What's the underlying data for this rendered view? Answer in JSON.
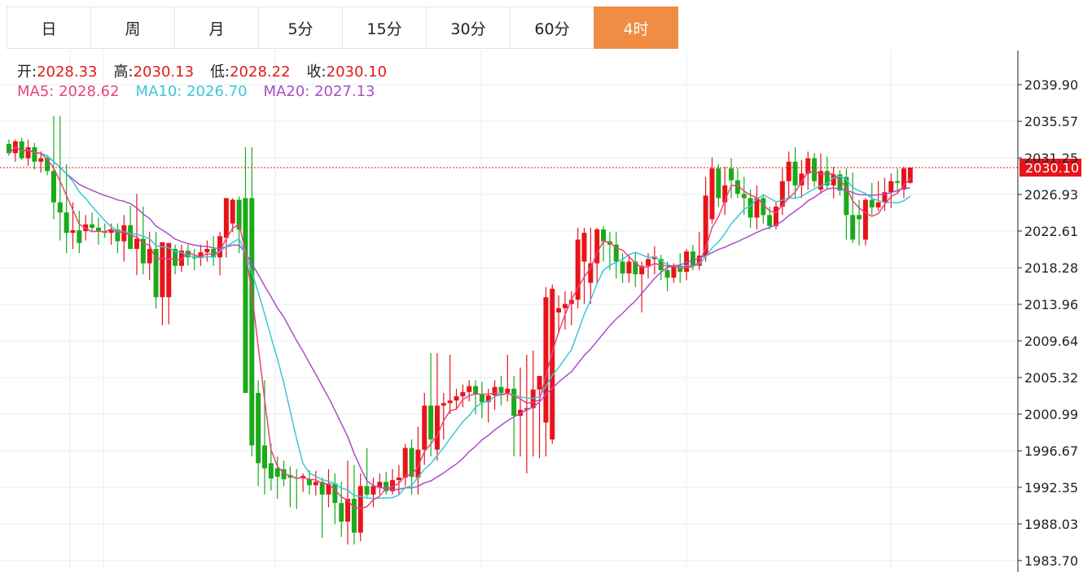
{
  "tabs": [
    {
      "label": "日",
      "active": false
    },
    {
      "label": "周",
      "active": false
    },
    {
      "label": "月",
      "active": false
    },
    {
      "label": "5分",
      "active": false
    },
    {
      "label": "15分",
      "active": false
    },
    {
      "label": "30分",
      "active": false
    },
    {
      "label": "60分",
      "active": false
    },
    {
      "label": "4时",
      "active": true
    }
  ],
  "ohlc": {
    "open_label": "开:",
    "open": "2028.33",
    "high_label": "高:",
    "high": "2030.13",
    "low_label": "低:",
    "low": "2028.22",
    "close_label": "收:",
    "close": "2030.10"
  },
  "ma": {
    "ma5_label": "MA5:",
    "ma5": "2028.62",
    "ma10_label": "MA10:",
    "ma10": "2026.70",
    "ma20_label": "MA20:",
    "ma20": "2027.13"
  },
  "colors": {
    "up": "#e8141a",
    "down": "#1aaa1a",
    "ma5": "#e8457a",
    "ma10": "#3cc7d6",
    "ma20": "#a94fc4",
    "accent": "#f08c44",
    "last_price_bg": "#e8141a"
  },
  "chart_data": {
    "type": "candlestick",
    "y_ticks": [
      "2039.90",
      "2035.57",
      "2031.25",
      "2026.93",
      "2022.61",
      "2018.28",
      "2013.96",
      "2009.64",
      "2005.32",
      "2000.99",
      "1996.67",
      "1992.35",
      "1988.03",
      "1983.70"
    ],
    "ylim": [
      1983.7,
      2039.9
    ],
    "last_price": "2030.10",
    "grid": true,
    "candles": [
      [
        2032.9,
        2033.4,
        2031.5,
        2031.8
      ],
      [
        2031.8,
        2033.4,
        2030.8,
        2033.2
      ],
      [
        2033.2,
        2033.6,
        2031.0,
        2031.2
      ],
      [
        2031.2,
        2033.4,
        2030.3,
        2032.5
      ],
      [
        2032.5,
        2033.0,
        2029.9,
        2030.8
      ],
      [
        2030.8,
        2032.0,
        2029.5,
        2031.2
      ],
      [
        2031.2,
        2031.6,
        2029.2,
        2029.7
      ],
      [
        2029.7,
        2036.2,
        2024.0,
        2026.0
      ],
      [
        2026.0,
        2036.2,
        2021.5,
        2024.8
      ],
      [
        2024.8,
        2030.5,
        2020.0,
        2022.4
      ],
      [
        2022.4,
        2026.0,
        2020.5,
        2022.7
      ],
      [
        2022.7,
        2025.0,
        2020.0,
        2021.2
      ],
      [
        2022.6,
        2024.5,
        2021.5,
        2023.4
      ],
      [
        2023.4,
        2024.8,
        2022.5,
        2023.0
      ],
      [
        2023.0,
        2024.2,
        2021.0,
        2022.6
      ],
      [
        2022.6,
        2023.5,
        2021.8,
        2022.4
      ],
      [
        2022.4,
        2023.5,
        2021.0,
        2022.8
      ],
      [
        2022.8,
        2023.5,
        2020.0,
        2021.4
      ],
      [
        2021.4,
        2024.5,
        2019.0,
        2023.3
      ],
      [
        2023.3,
        2025.6,
        2020.5,
        2020.5
      ],
      [
        2020.5,
        2027.0,
        2017.4,
        2021.7
      ],
      [
        2021.7,
        2025.5,
        2017.5,
        2018.8
      ],
      [
        2018.8,
        2022.5,
        2016.8,
        2020.5
      ],
      [
        2020.5,
        2022.5,
        2013.5,
        2014.8
      ],
      [
        2014.8,
        2021.0,
        2011.5,
        2021.3
      ],
      [
        2014.8,
        2021.0,
        2011.6,
        2021.2
      ],
      [
        2020.5,
        2021.0,
        2017.5,
        2018.5
      ],
      [
        2018.5,
        2021.0,
        2017.8,
        2020.3
      ],
      [
        2020.3,
        2021.0,
        2018.5,
        2019.5
      ],
      [
        2019.5,
        2020.5,
        2018.0,
        2019.4
      ],
      [
        2019.5,
        2021.0,
        2018.5,
        2020.1
      ],
      [
        2020.1,
        2021.5,
        2019.0,
        2020.5
      ],
      [
        2020.5,
        2022.0,
        2018.5,
        2019.5
      ],
      [
        2019.5,
        2022.5,
        2017.4,
        2022.0
      ],
      [
        2021.8,
        2024.5,
        2019.5,
        2026.5
      ],
      [
        2023.5,
        2026.5,
        2022.5,
        2026.3
      ],
      [
        2026.3,
        2026.7,
        2020.0,
        2022.8
      ],
      [
        2026.5,
        2032.5,
        2005.0,
        2003.5
      ],
      [
        2026.5,
        2032.5,
        1996.0,
        1997.3
      ],
      [
        2003.5,
        2005.0,
        1992.5,
        1995.2
      ],
      [
        1997.3,
        2005.0,
        1991.5,
        1994.6
      ],
      [
        1995.2,
        1997.5,
        1992.0,
        1993.4
      ],
      [
        1994.6,
        1996.0,
        1991.0,
        1993.6
      ],
      [
        1994.5,
        1995.5,
        1992.5,
        1993.3
      ],
      [
        1993.8,
        1994.8,
        1990.0,
        1993.5
      ],
      [
        1993.5,
        1994.5,
        1989.8,
        1993.4
      ],
      [
        1993.4,
        1994.0,
        1991.8,
        1993.7
      ],
      [
        1993.3,
        1994.4,
        1991.5,
        1992.6
      ],
      [
        1992.6,
        1994.3,
        1991.4,
        1993.0
      ],
      [
        1993.0,
        1993.5,
        1986.4,
        1991.5
      ],
      [
        1991.5,
        1994.5,
        1990.0,
        1992.8
      ],
      [
        1992.8,
        1994.0,
        1988.0,
        1990.5
      ],
      [
        1990.5,
        1993.0,
        1986.5,
        1988.3
      ],
      [
        1988.3,
        1995.5,
        1985.6,
        1991.0
      ],
      [
        1991.0,
        1995.0,
        1985.6,
        1987.0
      ],
      [
        1987.0,
        1994.0,
        1986.0,
        1992.5
      ],
      [
        1992.5,
        1997.0,
        1991.2,
        1991.5
      ],
      [
        1991.5,
        1993.5,
        1990.0,
        1992.5
      ],
      [
        1992.3,
        1994.0,
        1991.5,
        1993.0
      ],
      [
        1993.0,
        1994.2,
        1991.5,
        1991.9
      ],
      [
        1991.9,
        1994.5,
        1991.5,
        1993.2
      ],
      [
        1993.2,
        1995.0,
        1991.5,
        1993.5
      ],
      [
        1993.5,
        1997.5,
        1992.5,
        1997.0
      ],
      [
        1997.0,
        1998.0,
        1991.5,
        1993.6
      ],
      [
        1993.5,
        1999.5,
        1991.5,
        1996.8
      ],
      [
        1996.8,
        2003.5,
        1995.0,
        2002.0
      ],
      [
        2002.0,
        2008.2,
        1996.0,
        1998.0
      ],
      [
        1996.8,
        2008.2,
        1995.5,
        2002.0
      ],
      [
        2002.0,
        2003.5,
        1998.0,
        2002.3
      ],
      [
        2002.3,
        2008.0,
        2001.0,
        2002.6
      ],
      [
        2002.6,
        2004.0,
        2001.5,
        2003.1
      ],
      [
        2003.1,
        2004.5,
        2001.8,
        2003.6
      ],
      [
        2003.6,
        2005.0,
        2002.5,
        2004.3
      ],
      [
        2004.3,
        2005.0,
        2001.0,
        2003.3
      ],
      [
        2003.3,
        2004.8,
        2000.5,
        2002.4
      ],
      [
        2002.4,
        2004.0,
        2000.0,
        2003.2
      ],
      [
        2003.2,
        2005.0,
        2001.5,
        2004.2
      ],
      [
        2004.2,
        2005.5,
        2002.0,
        2003.5
      ],
      [
        2003.5,
        2008.0,
        2002.5,
        2004.0
      ],
      [
        2004.0,
        2005.5,
        1996.0,
        2000.8
      ],
      [
        2000.8,
        2006.5,
        1996.0,
        2001.5
      ],
      [
        2001.5,
        2008.0,
        1994.0,
        2001.7
      ],
      [
        2001.7,
        2008.5,
        1996.0,
        2003.9
      ],
      [
        2003.9,
        2005.0,
        1995.8,
        2005.5
      ],
      [
        2000.0,
        2016.0,
        1996.0,
        2014.8
      ],
      [
        1998.0,
        2016.3,
        1997.5,
        2015.8
      ],
      [
        2013.0,
        2015.0,
        2010.5,
        2013.5
      ],
      [
        2013.5,
        2015.5,
        2011.0,
        2014.0
      ],
      [
        2014.0,
        2015.5,
        2011.5,
        2014.5
      ],
      [
        2014.5,
        2023.0,
        2013.5,
        2021.6
      ],
      [
        2019.0,
        2023.0,
        2014.0,
        2022.4
      ],
      [
        2016.5,
        2023.0,
        2014.0,
        2018.8
      ],
      [
        2018.8,
        2023.0,
        2016.5,
        2022.8
      ],
      [
        2022.8,
        2023.2,
        2019.0,
        2021.4
      ],
      [
        2021.4,
        2022.5,
        2018.0,
        2021.0
      ],
      [
        2021.0,
        2022.5,
        2017.0,
        2019.0
      ],
      [
        2019.0,
        2020.0,
        2016.5,
        2017.6
      ],
      [
        2017.6,
        2019.8,
        2016.5,
        2019.0
      ],
      [
        2019.0,
        2020.0,
        2016.0,
        2017.5
      ],
      [
        2017.5,
        2019.0,
        2013.0,
        2018.5
      ],
      [
        2018.5,
        2020.0,
        2017.0,
        2019.3
      ],
      [
        2019.3,
        2020.8,
        2017.5,
        2019.6
      ],
      [
        2019.3,
        2019.8,
        2016.8,
        2018.0
      ],
      [
        2018.0,
        2019.0,
        2015.5,
        2017.1
      ],
      [
        2017.1,
        2018.8,
        2016.5,
        2018.5
      ],
      [
        2018.5,
        2020.0,
        2016.5,
        2017.8
      ],
      [
        2017.8,
        2020.5,
        2016.8,
        2020.2
      ],
      [
        2020.2,
        2021.0,
        2018.0,
        2018.5
      ],
      [
        2018.5,
        2022.5,
        2018.0,
        2019.7
      ],
      [
        2019.7,
        2029.0,
        2019.0,
        2026.8
      ],
      [
        2024.0,
        2031.3,
        2023.5,
        2030.0
      ],
      [
        2030.0,
        2030.5,
        2025.5,
        2026.5
      ],
      [
        2026.0,
        2030.2,
        2024.5,
        2028.0
      ],
      [
        2030.0,
        2031.2,
        2026.5,
        2028.6
      ],
      [
        2028.6,
        2030.0,
        2026.5,
        2027.0
      ],
      [
        2027.0,
        2029.0,
        2024.5,
        2026.5
      ],
      [
        2026.5,
        2027.5,
        2023.0,
        2024.2
      ],
      [
        2024.2,
        2028.0,
        2022.8,
        2026.5
      ],
      [
        2026.5,
        2027.0,
        2023.5,
        2024.5
      ],
      [
        2024.5,
        2025.5,
        2022.8,
        2023.2
      ],
      [
        2023.2,
        2026.0,
        2022.8,
        2025.5
      ],
      [
        2025.5,
        2030.0,
        2024.5,
        2028.5
      ],
      [
        2028.5,
        2032.0,
        2026.5,
        2030.8
      ],
      [
        2030.8,
        2032.5,
        2026.5,
        2028.0
      ],
      [
        2028.0,
        2031.0,
        2026.5,
        2029.4
      ],
      [
        2029.4,
        2032.0,
        2027.5,
        2031.2
      ],
      [
        2031.2,
        2031.8,
        2027.8,
        2028.5
      ],
      [
        2027.5,
        2031.8,
        2027.0,
        2029.7
      ],
      [
        2029.7,
        2031.4,
        2027.5,
        2028.0
      ],
      [
        2028.0,
        2030.2,
        2026.5,
        2029.3
      ],
      [
        2029.3,
        2029.8,
        2026.8,
        2027.4
      ],
      [
        2029.0,
        2030.0,
        2021.6,
        2024.5
      ],
      [
        2024.5,
        2029.5,
        2021.2,
        2021.6
      ],
      [
        2024.5,
        2026.3,
        2020.9,
        2024.0
      ],
      [
        2021.6,
        2026.5,
        2020.9,
        2026.3
      ],
      [
        2026.3,
        2028.3,
        2024.5,
        2025.4
      ],
      [
        2025.4,
        2028.5,
        2025.0,
        2026.0
      ],
      [
        2026.0,
        2028.9,
        2025.0,
        2027.2
      ],
      [
        2027.2,
        2029.4,
        2025.3,
        2028.5
      ],
      [
        2028.5,
        2030.0,
        2027.0,
        2028.3
      ],
      [
        2027.5,
        2030.2,
        2026.5,
        2030.0
      ],
      [
        2028.3,
        2030.1,
        2028.2,
        2030.1
      ]
    ]
  }
}
